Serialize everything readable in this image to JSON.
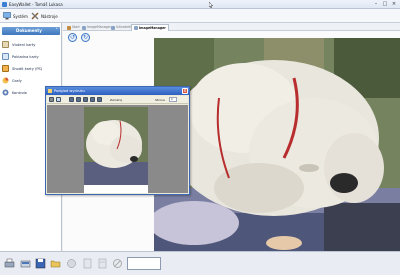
{
  "window": {
    "title": "EasyWallet - Tomáš Lukasa"
  },
  "menu": {
    "items": [
      {
        "label": "Systém"
      },
      {
        "label": "Nástroje"
      }
    ]
  },
  "sidebar": {
    "header": "Dokumenty",
    "items": [
      {
        "label": "Vložení karty"
      },
      {
        "label": "Pokladna karty"
      },
      {
        "label": "Shodit karty (PS)"
      },
      {
        "label": "Grafy"
      },
      {
        "label": "Kontrola"
      }
    ]
  },
  "tabs": [
    {
      "label": "Start"
    },
    {
      "label": "ImageManager"
    },
    {
      "label": "Užívatelé"
    },
    {
      "label": "ImageManager"
    }
  ],
  "dialog": {
    "title": "Podglad wydruku",
    "close_label": "x",
    "close_button": "Zamknij",
    "page_label": "Strona",
    "page_value": "1"
  },
  "statusbar": {
    "field_value": ""
  }
}
